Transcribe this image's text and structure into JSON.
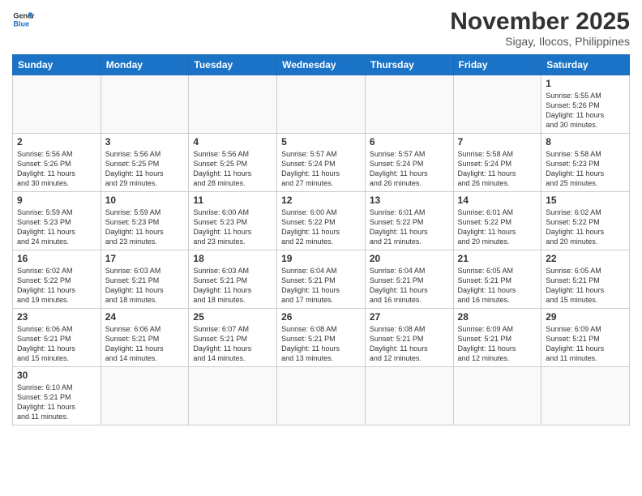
{
  "header": {
    "logo_general": "General",
    "logo_blue": "Blue",
    "month_title": "November 2025",
    "location": "Sigay, Ilocos, Philippines"
  },
  "weekdays": [
    "Sunday",
    "Monday",
    "Tuesday",
    "Wednesday",
    "Thursday",
    "Friday",
    "Saturday"
  ],
  "weeks": [
    [
      {
        "day": "",
        "info": ""
      },
      {
        "day": "",
        "info": ""
      },
      {
        "day": "",
        "info": ""
      },
      {
        "day": "",
        "info": ""
      },
      {
        "day": "",
        "info": ""
      },
      {
        "day": "",
        "info": ""
      },
      {
        "day": "1",
        "info": "Sunrise: 5:55 AM\nSunset: 5:26 PM\nDaylight: 11 hours\nand 30 minutes."
      }
    ],
    [
      {
        "day": "2",
        "info": "Sunrise: 5:56 AM\nSunset: 5:26 PM\nDaylight: 11 hours\nand 30 minutes."
      },
      {
        "day": "3",
        "info": "Sunrise: 5:56 AM\nSunset: 5:25 PM\nDaylight: 11 hours\nand 29 minutes."
      },
      {
        "day": "4",
        "info": "Sunrise: 5:56 AM\nSunset: 5:25 PM\nDaylight: 11 hours\nand 28 minutes."
      },
      {
        "day": "5",
        "info": "Sunrise: 5:57 AM\nSunset: 5:24 PM\nDaylight: 11 hours\nand 27 minutes."
      },
      {
        "day": "6",
        "info": "Sunrise: 5:57 AM\nSunset: 5:24 PM\nDaylight: 11 hours\nand 26 minutes."
      },
      {
        "day": "7",
        "info": "Sunrise: 5:58 AM\nSunset: 5:24 PM\nDaylight: 11 hours\nand 26 minutes."
      },
      {
        "day": "8",
        "info": "Sunrise: 5:58 AM\nSunset: 5:23 PM\nDaylight: 11 hours\nand 25 minutes."
      }
    ],
    [
      {
        "day": "9",
        "info": "Sunrise: 5:59 AM\nSunset: 5:23 PM\nDaylight: 11 hours\nand 24 minutes."
      },
      {
        "day": "10",
        "info": "Sunrise: 5:59 AM\nSunset: 5:23 PM\nDaylight: 11 hours\nand 23 minutes."
      },
      {
        "day": "11",
        "info": "Sunrise: 6:00 AM\nSunset: 5:23 PM\nDaylight: 11 hours\nand 23 minutes."
      },
      {
        "day": "12",
        "info": "Sunrise: 6:00 AM\nSunset: 5:22 PM\nDaylight: 11 hours\nand 22 minutes."
      },
      {
        "day": "13",
        "info": "Sunrise: 6:01 AM\nSunset: 5:22 PM\nDaylight: 11 hours\nand 21 minutes."
      },
      {
        "day": "14",
        "info": "Sunrise: 6:01 AM\nSunset: 5:22 PM\nDaylight: 11 hours\nand 20 minutes."
      },
      {
        "day": "15",
        "info": "Sunrise: 6:02 AM\nSunset: 5:22 PM\nDaylight: 11 hours\nand 20 minutes."
      }
    ],
    [
      {
        "day": "16",
        "info": "Sunrise: 6:02 AM\nSunset: 5:22 PM\nDaylight: 11 hours\nand 19 minutes."
      },
      {
        "day": "17",
        "info": "Sunrise: 6:03 AM\nSunset: 5:21 PM\nDaylight: 11 hours\nand 18 minutes."
      },
      {
        "day": "18",
        "info": "Sunrise: 6:03 AM\nSunset: 5:21 PM\nDaylight: 11 hours\nand 18 minutes."
      },
      {
        "day": "19",
        "info": "Sunrise: 6:04 AM\nSunset: 5:21 PM\nDaylight: 11 hours\nand 17 minutes."
      },
      {
        "day": "20",
        "info": "Sunrise: 6:04 AM\nSunset: 5:21 PM\nDaylight: 11 hours\nand 16 minutes."
      },
      {
        "day": "21",
        "info": "Sunrise: 6:05 AM\nSunset: 5:21 PM\nDaylight: 11 hours\nand 16 minutes."
      },
      {
        "day": "22",
        "info": "Sunrise: 6:05 AM\nSunset: 5:21 PM\nDaylight: 11 hours\nand 15 minutes."
      }
    ],
    [
      {
        "day": "23",
        "info": "Sunrise: 6:06 AM\nSunset: 5:21 PM\nDaylight: 11 hours\nand 15 minutes."
      },
      {
        "day": "24",
        "info": "Sunrise: 6:06 AM\nSunset: 5:21 PM\nDaylight: 11 hours\nand 14 minutes."
      },
      {
        "day": "25",
        "info": "Sunrise: 6:07 AM\nSunset: 5:21 PM\nDaylight: 11 hours\nand 14 minutes."
      },
      {
        "day": "26",
        "info": "Sunrise: 6:08 AM\nSunset: 5:21 PM\nDaylight: 11 hours\nand 13 minutes."
      },
      {
        "day": "27",
        "info": "Sunrise: 6:08 AM\nSunset: 5:21 PM\nDaylight: 11 hours\nand 12 minutes."
      },
      {
        "day": "28",
        "info": "Sunrise: 6:09 AM\nSunset: 5:21 PM\nDaylight: 11 hours\nand 12 minutes."
      },
      {
        "day": "29",
        "info": "Sunrise: 6:09 AM\nSunset: 5:21 PM\nDaylight: 11 hours\nand 11 minutes."
      }
    ],
    [
      {
        "day": "30",
        "info": "Sunrise: 6:10 AM\nSunset: 5:21 PM\nDaylight: 11 hours\nand 11 minutes."
      },
      {
        "day": "",
        "info": ""
      },
      {
        "day": "",
        "info": ""
      },
      {
        "day": "",
        "info": ""
      },
      {
        "day": "",
        "info": ""
      },
      {
        "day": "",
        "info": ""
      },
      {
        "day": "",
        "info": ""
      }
    ]
  ]
}
